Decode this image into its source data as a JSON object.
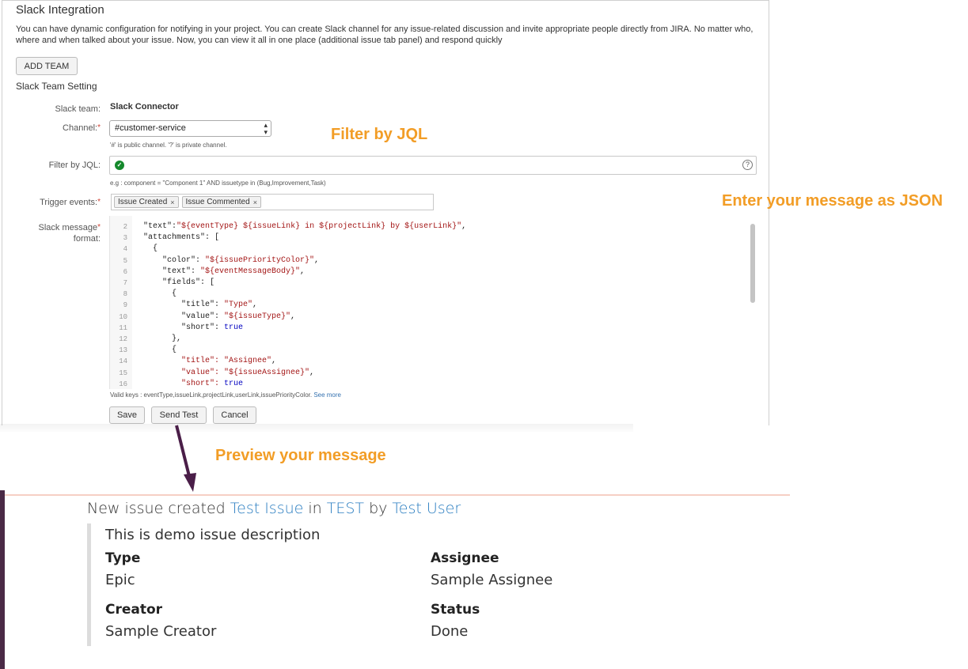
{
  "panel": {
    "title": "Slack Integration",
    "description": "You can have dynamic configuration for notifying in your project. You can create Slack channel for any issue-related discussion and invite appropriate people directly from JIRA. No matter who, where and when talked about your issue. Now, you can view it all in one place (additional issue tab panel) and respond quickly",
    "add_team_label": "ADD TEAM",
    "setting_title": "Slack Team Setting"
  },
  "form": {
    "team_label": "Slack team:",
    "team_value": "Slack Connector",
    "channel_label": "Channel:",
    "channel_value": "#customer-service",
    "channel_hint": "'#' is public channel. '?' is private channel.",
    "jql_label": "Filter by JQL:",
    "jql_value": "",
    "jql_example": "e.g : component = \"Component 1\" AND issuetype in (Bug,Improvement,Task)",
    "trigger_label": "Trigger events:",
    "trigger_tags": [
      "Issue Created",
      "Issue Commented"
    ],
    "format_label_1": "Slack message",
    "format_label_2": "format:",
    "valid_keys": "Valid keys : eventType,issueLink,projectLink,userLink,issuePriorityColor. ",
    "see_more": "See more",
    "save_label": "Save",
    "send_test_label": "Send Test",
    "cancel_label": "Cancel"
  },
  "code_lines": [
    {
      "n": "2",
      "segs": [
        [
          "  ",
          ""
        ],
        [
          "\"text\"",
          ""
        ],
        [
          ":",
          ""
        ],
        [
          "\"${eventType} ${issueLink} in ${projectLink} by ${userLink}\"",
          "s"
        ],
        [
          ",",
          ""
        ]
      ]
    },
    {
      "n": "3",
      "segs": [
        [
          "  \"attachments\": [",
          ""
        ]
      ]
    },
    {
      "n": "4",
      "segs": [
        [
          "    {",
          ""
        ]
      ]
    },
    {
      "n": "5",
      "segs": [
        [
          "      \"color\": ",
          ""
        ],
        [
          "\"${issuePriorityColor}\"",
          "s"
        ],
        [
          ",",
          ""
        ]
      ]
    },
    {
      "n": "6",
      "segs": [
        [
          "      \"text\": ",
          ""
        ],
        [
          "\"${eventMessageBody}\"",
          "s"
        ],
        [
          ",",
          ""
        ]
      ]
    },
    {
      "n": "7",
      "segs": [
        [
          "      \"fields\": [",
          ""
        ]
      ]
    },
    {
      "n": "8",
      "segs": [
        [
          "        {",
          ""
        ]
      ]
    },
    {
      "n": "9",
      "segs": [
        [
          "          \"title\": ",
          ""
        ],
        [
          "\"Type\"",
          "s"
        ],
        [
          ",",
          ""
        ]
      ]
    },
    {
      "n": "10",
      "segs": [
        [
          "          \"value\": ",
          ""
        ],
        [
          "\"${issueType}\"",
          "s"
        ],
        [
          ",",
          ""
        ]
      ]
    },
    {
      "n": "11",
      "segs": [
        [
          "          \"short\": ",
          ""
        ],
        [
          "true",
          "k"
        ]
      ]
    },
    {
      "n": "12",
      "segs": [
        [
          "        },",
          ""
        ]
      ]
    },
    {
      "n": "13",
      "segs": [
        [
          "        {",
          ""
        ]
      ]
    },
    {
      "n": "14",
      "segs": [
        [
          "          ",
          ""
        ],
        [
          "\"title\": \"Assignee\"",
          "s"
        ],
        [
          ",",
          ""
        ]
      ]
    },
    {
      "n": "15",
      "segs": [
        [
          "          ",
          ""
        ],
        [
          "\"value\": \"${issueAssignee}\"",
          "s"
        ],
        [
          ",",
          ""
        ]
      ]
    },
    {
      "n": "16",
      "segs": [
        [
          "          ",
          ""
        ],
        [
          "\"short\": ",
          "s"
        ],
        [
          "true",
          "k"
        ]
      ]
    }
  ],
  "notes": {
    "filter_jql": "Filter by JQL",
    "enter_json": "Enter your message as JSON",
    "preview": "Preview your message"
  },
  "preview": {
    "prefix": "New issue created ",
    "issue_link": "Test Issue",
    "in_word": " in ",
    "project_link": "TEST",
    "by_word": " by ",
    "user_link": "Test User",
    "body": "This is demo issue description",
    "fields": {
      "type_title": "Type",
      "type_value": "Epic",
      "assignee_title": "Assignee",
      "assignee_value": "Sample Assignee",
      "creator_title": "Creator",
      "creator_value": "Sample Creator",
      "status_title": "Status",
      "status_value": "Done"
    }
  },
  "colors": {
    "annotation": "#f29d26",
    "link": "#2b7ec1",
    "arrow": "#4a1e48",
    "required": "#d04437"
  }
}
